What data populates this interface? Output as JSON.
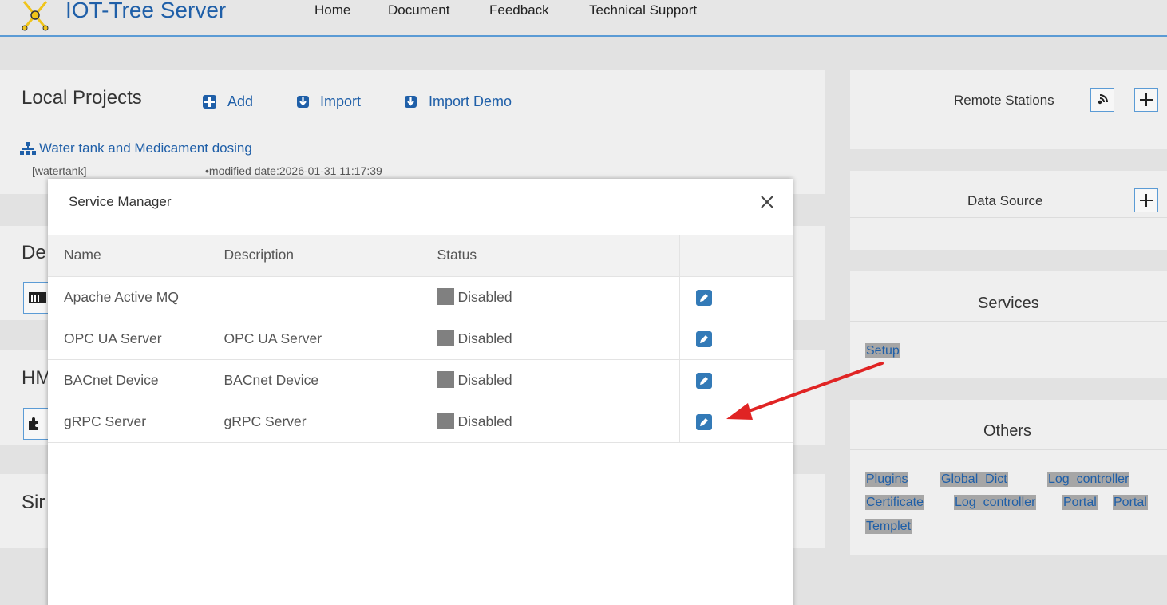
{
  "header": {
    "app_title": "IOT-Tree Server",
    "nav": [
      "Home",
      "Document",
      "Feedback",
      "Technical Support"
    ]
  },
  "local_projects": {
    "title": "Local Projects",
    "actions": [
      "Add",
      "Import",
      "Import Demo"
    ],
    "project": {
      "name": "Water tank and Medicament dosing",
      "id": "[watertank]",
      "modified": "•modified date:2026-01-31 11:17:39"
    }
  },
  "background_panels": {
    "de_partial": "De",
    "hm_partial": "HM",
    "si_partial": "Sir"
  },
  "sidebar": {
    "remote_stations": "Remote Stations",
    "data_source": "Data Source",
    "services": "Services",
    "services_setup": "Setup",
    "others": "Others",
    "others_links": [
      "Plugins",
      "Global  Dict",
      "Log  controller",
      "Certificate",
      "Log  controller",
      "Portal",
      "Portal",
      "Templet"
    ]
  },
  "modal": {
    "title": "Service Manager",
    "columns": [
      "Name",
      "Description",
      "Status",
      ""
    ],
    "rows": [
      {
        "name": "Apache Active MQ",
        "description": "",
        "status": "Disabled"
      },
      {
        "name": "OPC UA Server",
        "description": "OPC UA Server",
        "status": "Disabled"
      },
      {
        "name": "BACnet Device",
        "description": "BACnet Device",
        "status": "Disabled"
      },
      {
        "name": "gRPC Server",
        "description": "gRPC Server",
        "status": "Disabled"
      }
    ]
  },
  "colors": {
    "accent": "#1f5fa8",
    "edit_button": "#337ab7",
    "status_disabled": "#808080",
    "annotation_arrow": "#e02424"
  }
}
